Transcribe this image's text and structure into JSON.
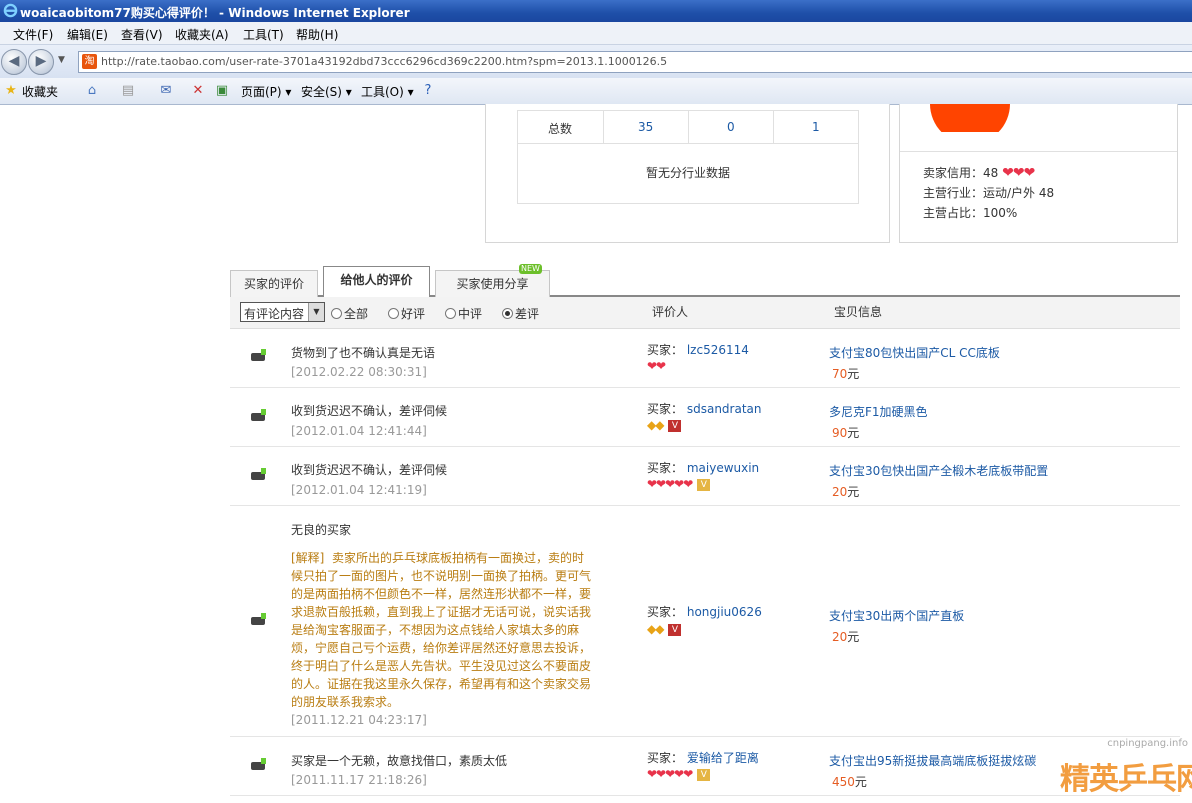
{
  "window": {
    "title": "woaicaobitom77购买心得评价！ - Windows Internet Explorer"
  },
  "menu": [
    "文件(F)",
    "编辑(E)",
    "查看(V)",
    "收藏夹(A)",
    "工具(T)",
    "帮助(H)"
  ],
  "address": {
    "url": "http://rate.taobao.com/user-rate-3701a43192dbd73ccc6296cd369c2200.htm?spm=2013.1.1000126.5",
    "favicon": "淘"
  },
  "commandbar": {
    "favorites": "收藏夹",
    "page": "页面(P)",
    "safety": "安全(S)",
    "tools": "工具(O)"
  },
  "stats": {
    "total_label": "总数",
    "values": [
      "35",
      "0",
      "1"
    ],
    "no_industry": "暂无分行业数据"
  },
  "seller": {
    "credit_label": "卖家信用：",
    "credit_value": "48",
    "industry_label": "主营行业：",
    "industry_value": "运动/户外  48",
    "share_label": "主营占比：",
    "share_value": "100%"
  },
  "tabs": [
    "买家的评价",
    "给他人的评价",
    "买家使用分享"
  ],
  "tab_badge": "NEW",
  "filter": {
    "select": "有评论内容",
    "options": [
      "全部",
      "好评",
      "中评",
      "差评"
    ],
    "col_rater": "评价人",
    "col_item": "宝贝信息"
  },
  "reviews": [
    {
      "comment": "货物到了也不确认真是无语",
      "date": "[2012.02.22 08:30:31]",
      "rater_label": "买家：",
      "rater": "lzc526114",
      "item": "支付宝80包快出国产CL CC底板",
      "price": "70",
      "unit": "元"
    },
    {
      "comment": "收到货迟迟不确认，差评伺候",
      "date": "[2012.01.04 12:41:44]",
      "rater_label": "买家：",
      "rater": "sdsandratan",
      "item": "多尼克F1加硬黑色",
      "price": "90",
      "unit": "元"
    },
    {
      "comment": "收到货迟迟不确认，差评伺候",
      "date": "[2012.01.04 12:41:19]",
      "rater_label": "买家：",
      "rater": "maiyewuxin",
      "item": "支付宝30包快出国产全椴木老底板带配置",
      "price": "20",
      "unit": "元"
    },
    {
      "comment": "无良的买家",
      "explain_label": "[解释]",
      "explain_lines": [
        "卖家所出的乒乓球底板拍柄有一面换过，卖的时",
        "候只拍了一面的图片，也不说明别一面换了拍柄。更可气",
        "的是两面拍柄不但颜色不一样，居然连形状都不一样，要",
        "求退款百般抵赖，直到我上了证据才无话可说，说实话我",
        "是给淘宝客服面子，不想因为这点钱给人家填太多的麻",
        "烦，宁愿自己亏个运费，给你差评居然还好意思去投诉，",
        "终于明白了什么是恶人先告状。平生没见过这么不要面皮",
        "的人。证据在我这里永久保存，希望再有和这个卖家交易",
        "的朋友联系我索求。"
      ],
      "date": "[2011.12.21 04:23:17]",
      "rater_label": "买家：",
      "rater": "hongjiu0626",
      "item": "支付宝30出两个国产直板",
      "price": "20",
      "unit": "元"
    },
    {
      "comment": "买家是一个无赖，故意找借口，素质太低",
      "date": "[2011.11.17 21:18:26]",
      "rater_label": "买家：",
      "rater": "爱输给了距离",
      "item": "支付宝出95新挺拔最高端底板挺拔炫碳",
      "price": "450",
      "unit": "元"
    }
  ],
  "watermark": {
    "site": "cnpingpang.info",
    "logo": "精英乒乓网"
  }
}
